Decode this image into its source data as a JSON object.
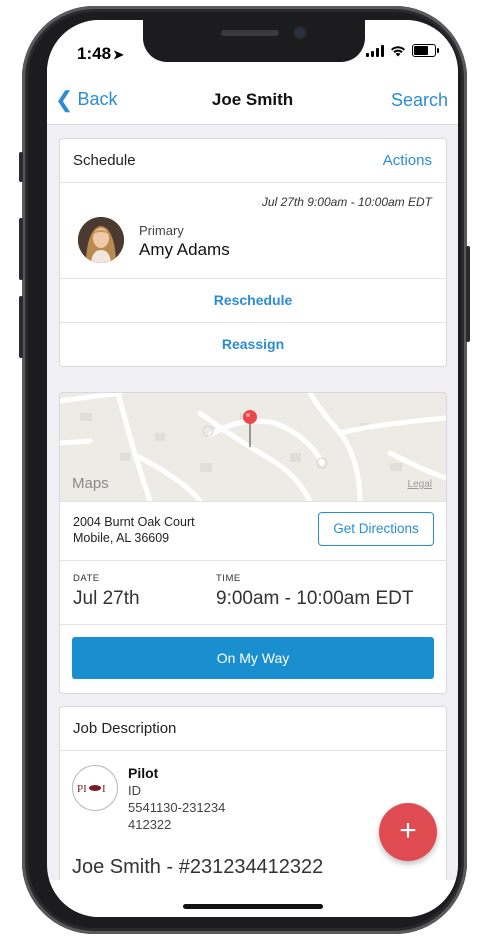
{
  "status_bar": {
    "time": "1:48"
  },
  "nav": {
    "back_label": "Back",
    "title": "Joe Smith",
    "search_label": "Search"
  },
  "schedule": {
    "title": "Schedule",
    "actions_label": "Actions",
    "appointment_time": "Jul 27th 9:00am - 10:00am EDT",
    "role": "Primary",
    "person": "Amy Adams",
    "reschedule_label": "Reschedule",
    "reassign_label": "Reassign"
  },
  "map": {
    "brand": "Maps",
    "legal": "Legal"
  },
  "location": {
    "address_line1": "2004 Burnt Oak Court",
    "address_line2": "Mobile, AL 36609",
    "directions_label": "Get Directions",
    "date_label": "DATE",
    "date_value": "Jul 27th",
    "time_label": "TIME",
    "time_value": "9:00am - 10:00am EDT",
    "on_my_way_label": "On My Way"
  },
  "job": {
    "title": "Job Description",
    "company": "Pilot",
    "line1": "ID",
    "line2": "5541130-231234",
    "line3": "412322",
    "job_name": "Joe Smith - #231234412322"
  },
  "fab": {
    "label": "+"
  },
  "colors": {
    "accent": "#2a8dd4",
    "primary_button": "#1a8fcf",
    "fab": "#e04b52"
  }
}
